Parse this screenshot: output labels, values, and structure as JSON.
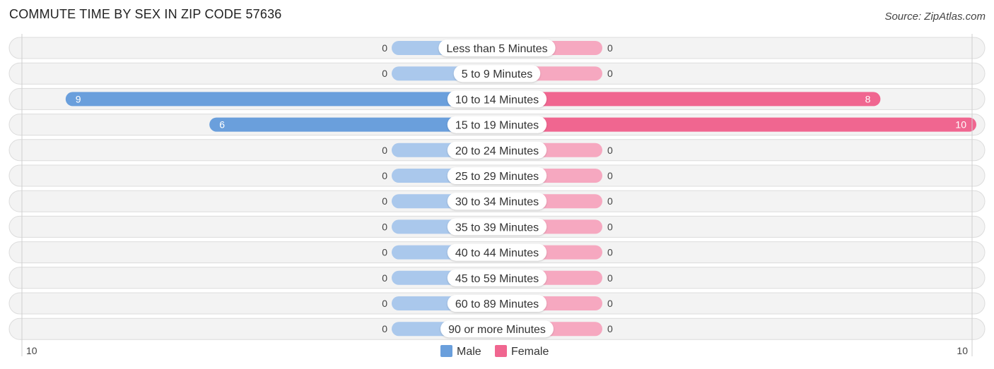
{
  "header": {
    "title": "COMMUTE TIME BY SEX IN ZIP CODE 57636",
    "source": "Source: ZipAtlas.com"
  },
  "chart_data": {
    "type": "bar",
    "orientation": "horizontal-diverging",
    "title": "COMMUTE TIME BY SEX IN ZIP CODE 57636",
    "categories": [
      "Less than 5 Minutes",
      "5 to 9 Minutes",
      "10 to 14 Minutes",
      "15 to 19 Minutes",
      "20 to 24 Minutes",
      "25 to 29 Minutes",
      "30 to 34 Minutes",
      "35 to 39 Minutes",
      "40 to 44 Minutes",
      "45 to 59 Minutes",
      "60 to 89 Minutes",
      "90 or more Minutes"
    ],
    "series": [
      {
        "name": "Male",
        "color": "#6a9fdc",
        "light_color": "#aac8ec",
        "values": [
          0,
          0,
          9,
          6,
          0,
          0,
          0,
          0,
          0,
          0,
          0,
          0
        ]
      },
      {
        "name": "Female",
        "color": "#f06690",
        "light_color": "#f6a8c0",
        "values": [
          0,
          0,
          8,
          10,
          0,
          0,
          0,
          0,
          0,
          0,
          0,
          0
        ]
      }
    ],
    "axis": {
      "left_label": "10",
      "right_label": "10",
      "max": 10
    },
    "legend": {
      "position": "bottom-center",
      "items": [
        "Male",
        "Female"
      ]
    },
    "grid": false
  }
}
